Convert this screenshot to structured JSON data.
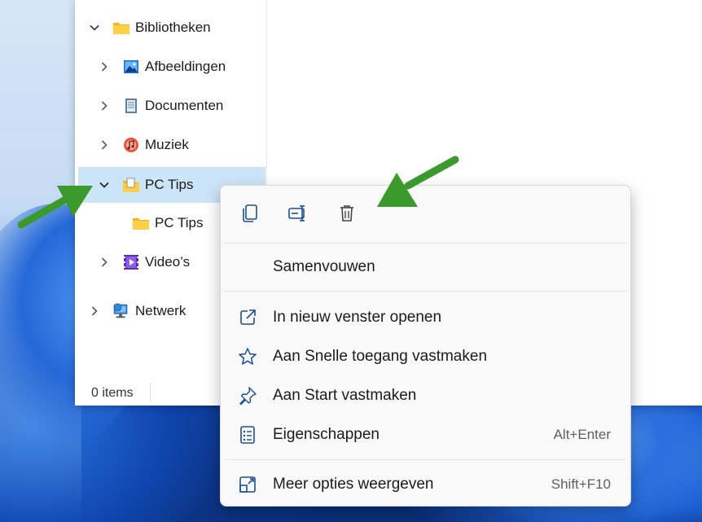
{
  "tree": {
    "items": [
      {
        "label": "Bibliotheken",
        "icon": "folder-yellow-icon",
        "expanded": true
      },
      {
        "label": "Afbeeldingen",
        "icon": "pictures-icon",
        "expanded": false
      },
      {
        "label": "Documenten",
        "icon": "documents-icon",
        "expanded": false
      },
      {
        "label": "Muziek",
        "icon": "music-icon",
        "expanded": false
      },
      {
        "label": "PC Tips",
        "icon": "library-folder-icon",
        "expanded": true,
        "selected": true
      },
      {
        "label": "PC Tips",
        "icon": "folder-yellow-icon"
      },
      {
        "label": "Video’s",
        "icon": "videos-icon",
        "expanded": false
      },
      {
        "label": "Netwerk",
        "icon": "network-icon",
        "expanded": false
      }
    ]
  },
  "status": {
    "items_count": "0 items"
  },
  "context_menu": {
    "quick_actions": [
      {
        "name": "copy-icon"
      },
      {
        "name": "rename-icon"
      },
      {
        "name": "trash-icon"
      }
    ],
    "items": [
      {
        "label": "Samenvouwen",
        "icon": "",
        "shortcut": ""
      },
      {
        "label": "In nieuw venster openen",
        "icon": "open-new-window-icon",
        "shortcut": ""
      },
      {
        "label": "Aan Snelle toegang vastmaken",
        "icon": "star-icon",
        "shortcut": ""
      },
      {
        "label": "Aan Start vastmaken",
        "icon": "pin-icon",
        "shortcut": ""
      },
      {
        "label": "Eigenschappen",
        "icon": "properties-icon",
        "shortcut": "Alt+Enter"
      },
      {
        "label": "Meer opties weergeven",
        "icon": "more-options-icon",
        "shortcut": "Shift+F10"
      }
    ]
  },
  "colors": {
    "selection": "#cce4f7",
    "accent": "#0067c0",
    "arrow": "#3a9a2b",
    "menu_bg": "#f9f9f9"
  }
}
